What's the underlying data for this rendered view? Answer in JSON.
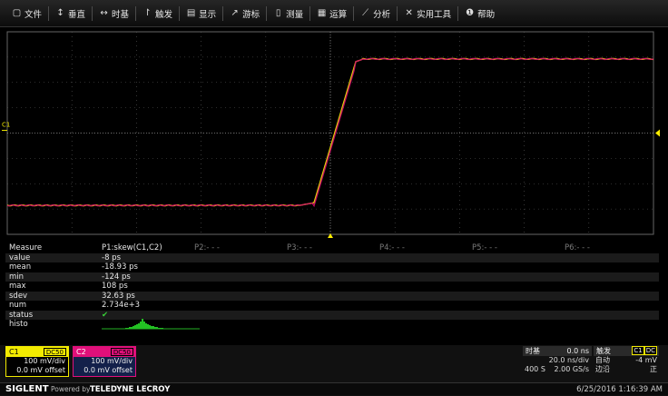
{
  "menu": {
    "items": [
      {
        "icon": "file-icon",
        "glyph": "▢",
        "label": "文件"
      },
      {
        "icon": "vertical-icon",
        "glyph": "↕",
        "label": "垂直"
      },
      {
        "icon": "horizontal-icon",
        "glyph": "↔",
        "label": "时基"
      },
      {
        "icon": "trigger-icon",
        "glyph": "↾",
        "label": "触发"
      },
      {
        "icon": "display-icon",
        "glyph": "▤",
        "label": "显示"
      },
      {
        "icon": "cursor-icon",
        "glyph": "↗",
        "label": "游标"
      },
      {
        "icon": "measure-icon",
        "glyph": "▯",
        "label": "测量"
      },
      {
        "icon": "math-icon",
        "glyph": "▦",
        "label": "运算"
      },
      {
        "icon": "analysis-icon",
        "glyph": "⟋",
        "label": "分析"
      },
      {
        "icon": "tools-icon",
        "glyph": "✕",
        "label": "实用工具"
      },
      {
        "icon": "help-icon",
        "glyph": "❶",
        "label": "帮助"
      }
    ]
  },
  "waveform": {
    "channel_marker": "C1",
    "colors": {
      "c1": "#e8e000",
      "c2": "#d0106a",
      "grid": "#5a5a5a",
      "trigger": "#ffee00"
    }
  },
  "measure": {
    "title": "Measure",
    "p1": "P1:skew(C1,C2)",
    "params": [
      "P2:- - -",
      "P3:- - -",
      "P4:- - -",
      "P5:- - -",
      "P6:- - -"
    ],
    "rows": [
      {
        "label": "value",
        "value": "-8 ps"
      },
      {
        "label": "mean",
        "value": "-18.93 ps"
      },
      {
        "label": "min",
        "value": "-124 ps"
      },
      {
        "label": "max",
        "value": "108 ps"
      },
      {
        "label": "sdev",
        "value": "32.63 ps"
      },
      {
        "label": "num",
        "value": "2.734e+3"
      },
      {
        "label": "status",
        "value": "✔"
      },
      {
        "label": "histo",
        "value": ""
      }
    ]
  },
  "channels": [
    {
      "name": "C1",
      "coupling": "DC50",
      "scale": "100 mV/div",
      "offset": "0.0 mV offset",
      "color": "#f2ea00"
    },
    {
      "name": "C2",
      "coupling": "DC50",
      "scale": "100 mV/div",
      "offset": "0.0 mV offset",
      "color": "#e0107a"
    }
  ],
  "timebase": {
    "title": "时基",
    "delay": "0.0 ns",
    "scale": "20.0 ns/div",
    "points": "400 S",
    "rate": "2.00 GS/s"
  },
  "trigger": {
    "title": "触发",
    "channel": "C1",
    "coupling": "DC",
    "mode": "自动",
    "level": "-4 mV",
    "type": "边沿",
    "slope": "正"
  },
  "status": {
    "brand": "SIGLENT",
    "powered": "Powered by",
    "partner": "TELEDYNE LECROY",
    "datetime": "6/25/2016 1:16:39 AM"
  }
}
